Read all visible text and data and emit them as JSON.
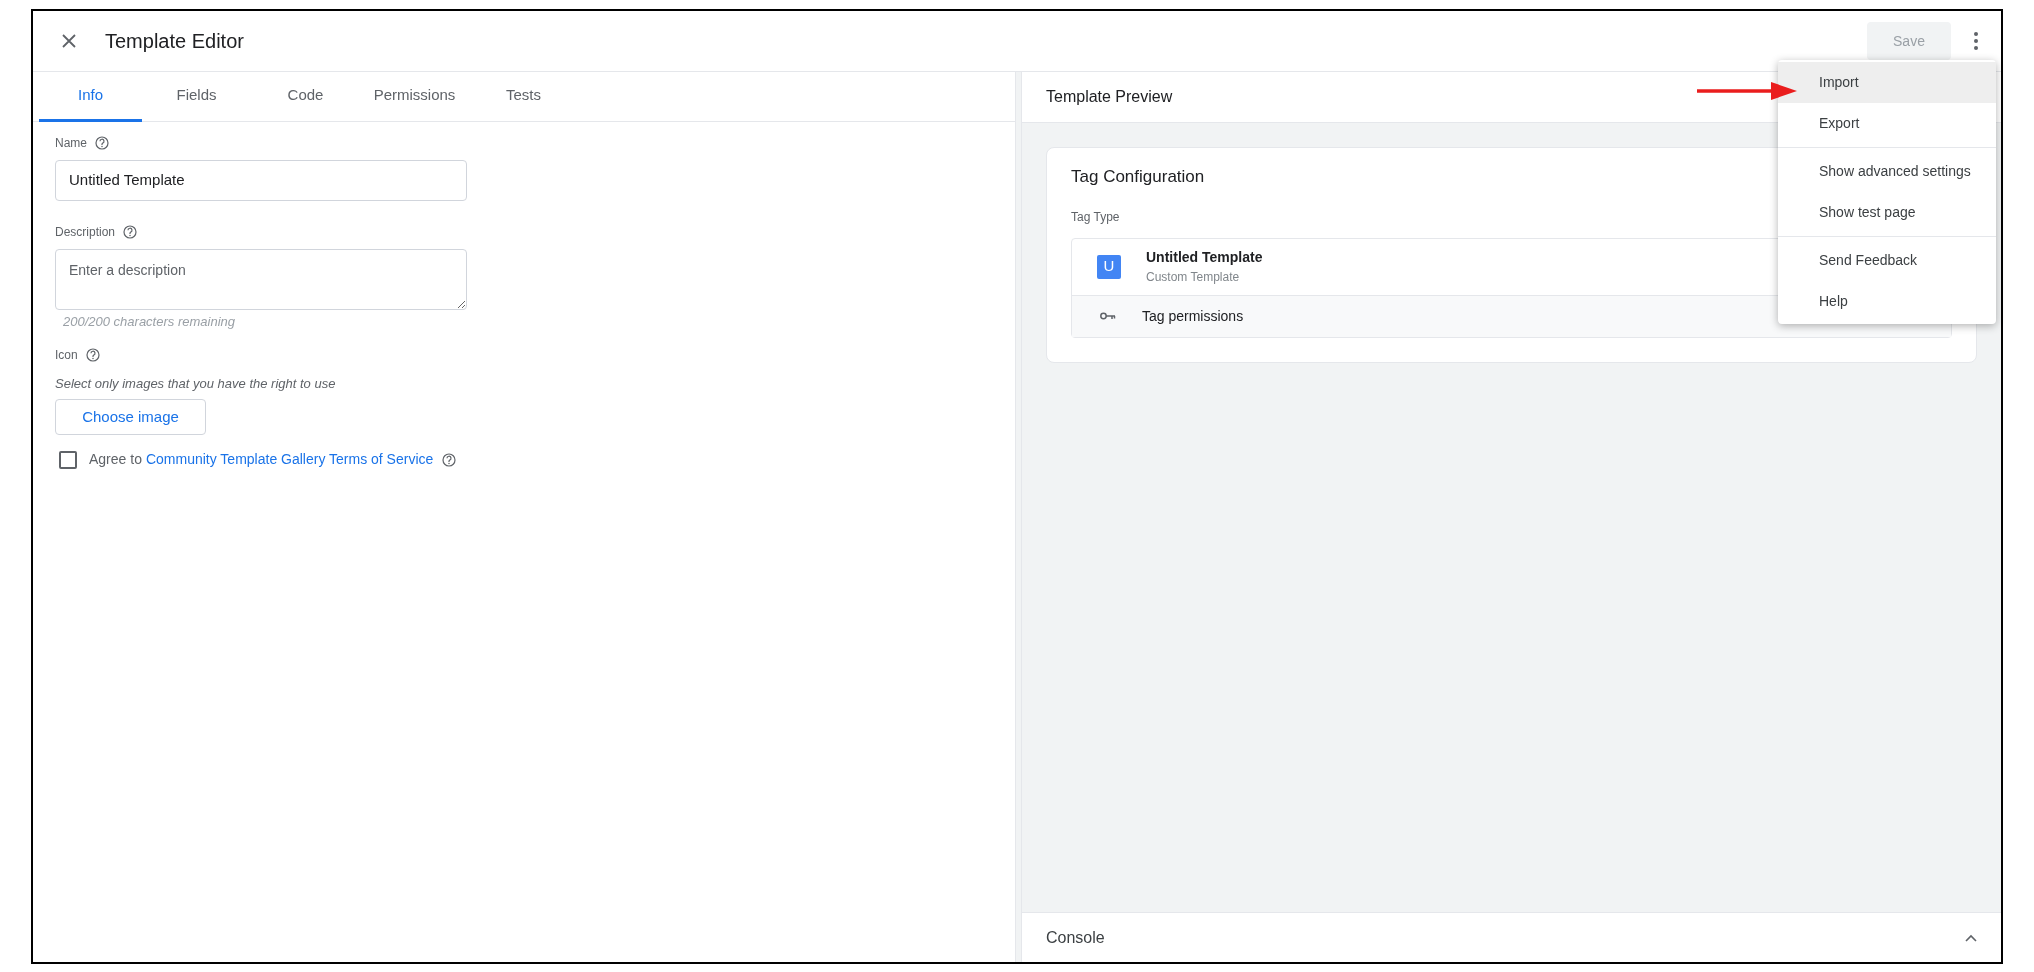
{
  "header": {
    "title": "Template Editor",
    "save_button": "Save",
    "save_disabled": true
  },
  "tabs": [
    {
      "label": "Info",
      "selected": true
    },
    {
      "label": "Fields",
      "selected": false
    },
    {
      "label": "Code",
      "selected": false
    },
    {
      "label": "Permissions",
      "selected": false
    },
    {
      "label": "Tests",
      "selected": false
    }
  ],
  "info": {
    "name_label": "Name",
    "name_value": "Untitled Template",
    "description_label": "Description",
    "description_placeholder": "Enter a description",
    "description_counter": "200/200 characters remaining",
    "icon_label": "Icon",
    "icon_hint": "Select only images that you have the right to use",
    "choose_image_button": "Choose image",
    "agree": {
      "text": "Agree to",
      "link": "Community Template Gallery Terms of Service",
      "checked": false
    }
  },
  "preview": {
    "title": "Template Preview",
    "card_title": "Tag Configuration",
    "tag_type_label": "Tag Type",
    "tag_badge": "U",
    "tag_name": "Untitled Template",
    "tag_subtitle": "Custom Template",
    "permissions": "Tag permissions",
    "console": "Console"
  },
  "menu": {
    "items": [
      {
        "label": "Import",
        "highlighted": true,
        "divider_after": false
      },
      {
        "label": "Export",
        "highlighted": false,
        "divider_after": true
      },
      {
        "label": "Show advanced settings",
        "highlighted": false,
        "divider_after": false
      },
      {
        "label": "Show test page",
        "highlighted": false,
        "divider_after": true
      },
      {
        "label": "Send Feedback",
        "highlighted": false,
        "divider_after": false
      },
      {
        "label": "Help",
        "highlighted": false,
        "divider_after": false
      }
    ]
  }
}
